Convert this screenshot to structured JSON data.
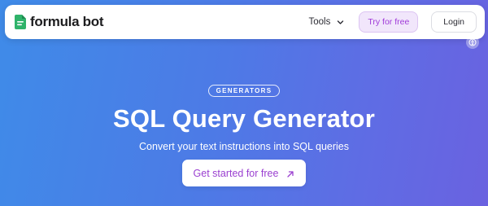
{
  "header": {
    "brand": "formula bot",
    "nav": {
      "tools_label": "Tools",
      "try_label": "Try for free",
      "login_label": "Login"
    }
  },
  "hero": {
    "badge": "GENERATORS",
    "title": "SQL Query Generator",
    "subtitle": "Convert your text instructions into SQL queries",
    "cta_label": "Get started for free"
  },
  "colors": {
    "brand_green": "#2fb36a",
    "accent_purple": "#a03bd9",
    "background_start": "#3f8be8",
    "background_end": "#6a62e0"
  },
  "icons": [
    "logo-icon",
    "chevron-down-icon",
    "accessibility-icon",
    "arrow-up-right-icon"
  ]
}
